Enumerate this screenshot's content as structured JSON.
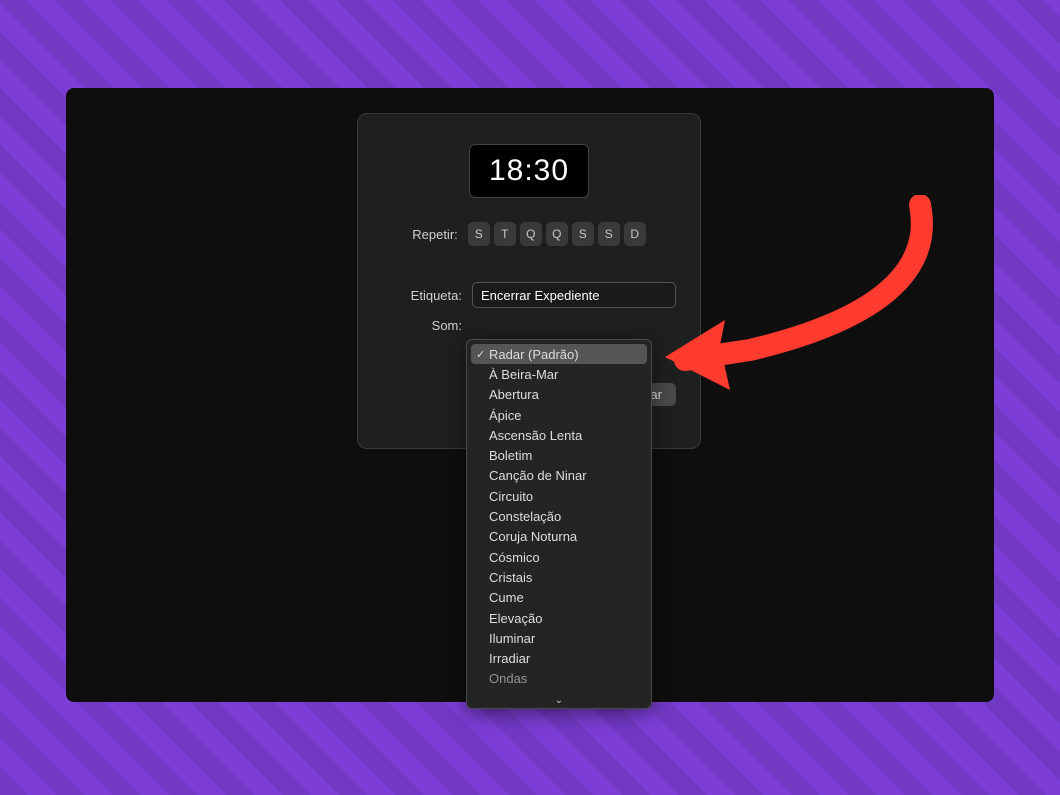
{
  "alarm": {
    "time": "18:30",
    "repeat_label": "Repetir:",
    "days": [
      "S",
      "T",
      "Q",
      "Q",
      "S",
      "S",
      "D"
    ],
    "etiqueta_label": "Etiqueta:",
    "etiqueta_value": "Encerrar Expediente",
    "som_label": "Som:",
    "save_label": "alvar"
  },
  "sound_options": {
    "selected": "Radar (Padrão)",
    "items": [
      "Radar (Padrão)",
      "À Beira-Mar",
      "Abertura",
      "Ápice",
      "Ascensão Lenta",
      "Boletim",
      "Canção de Ninar",
      "Circuito",
      "Constelação",
      "Coruja Noturna",
      "Cósmico",
      "Cristais",
      "Cume",
      "Elevação",
      "Iluminar",
      "Irradiar",
      "Ondas"
    ]
  },
  "colors": {
    "background": "#7c3ed6",
    "arrow": "#ff3b30"
  }
}
